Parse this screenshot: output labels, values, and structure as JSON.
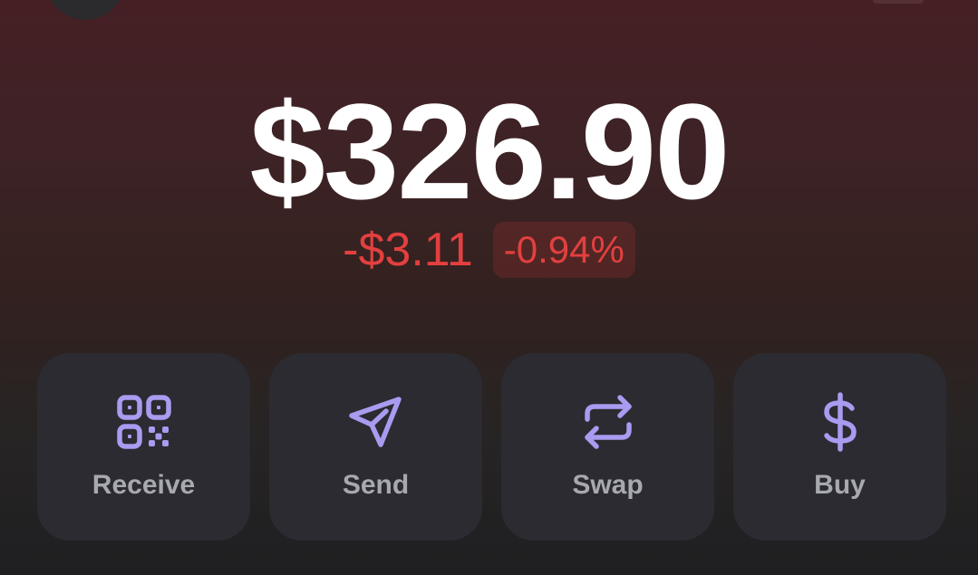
{
  "balance": {
    "total": "$326.90",
    "change_amount": "-$3.11",
    "change_percent": "-0.94%"
  },
  "actions": [
    {
      "label": "Receive",
      "icon": "qr-code-icon"
    },
    {
      "label": "Send",
      "icon": "send-icon"
    },
    {
      "label": "Swap",
      "icon": "swap-arrows-icon"
    },
    {
      "label": "Buy",
      "icon": "dollar-icon"
    }
  ],
  "colors": {
    "accent": "#a99bf0",
    "negative": "#e2403f",
    "card": "#2b2b31",
    "text_primary": "#ffffff",
    "text_secondary": "#a8a8b0"
  }
}
